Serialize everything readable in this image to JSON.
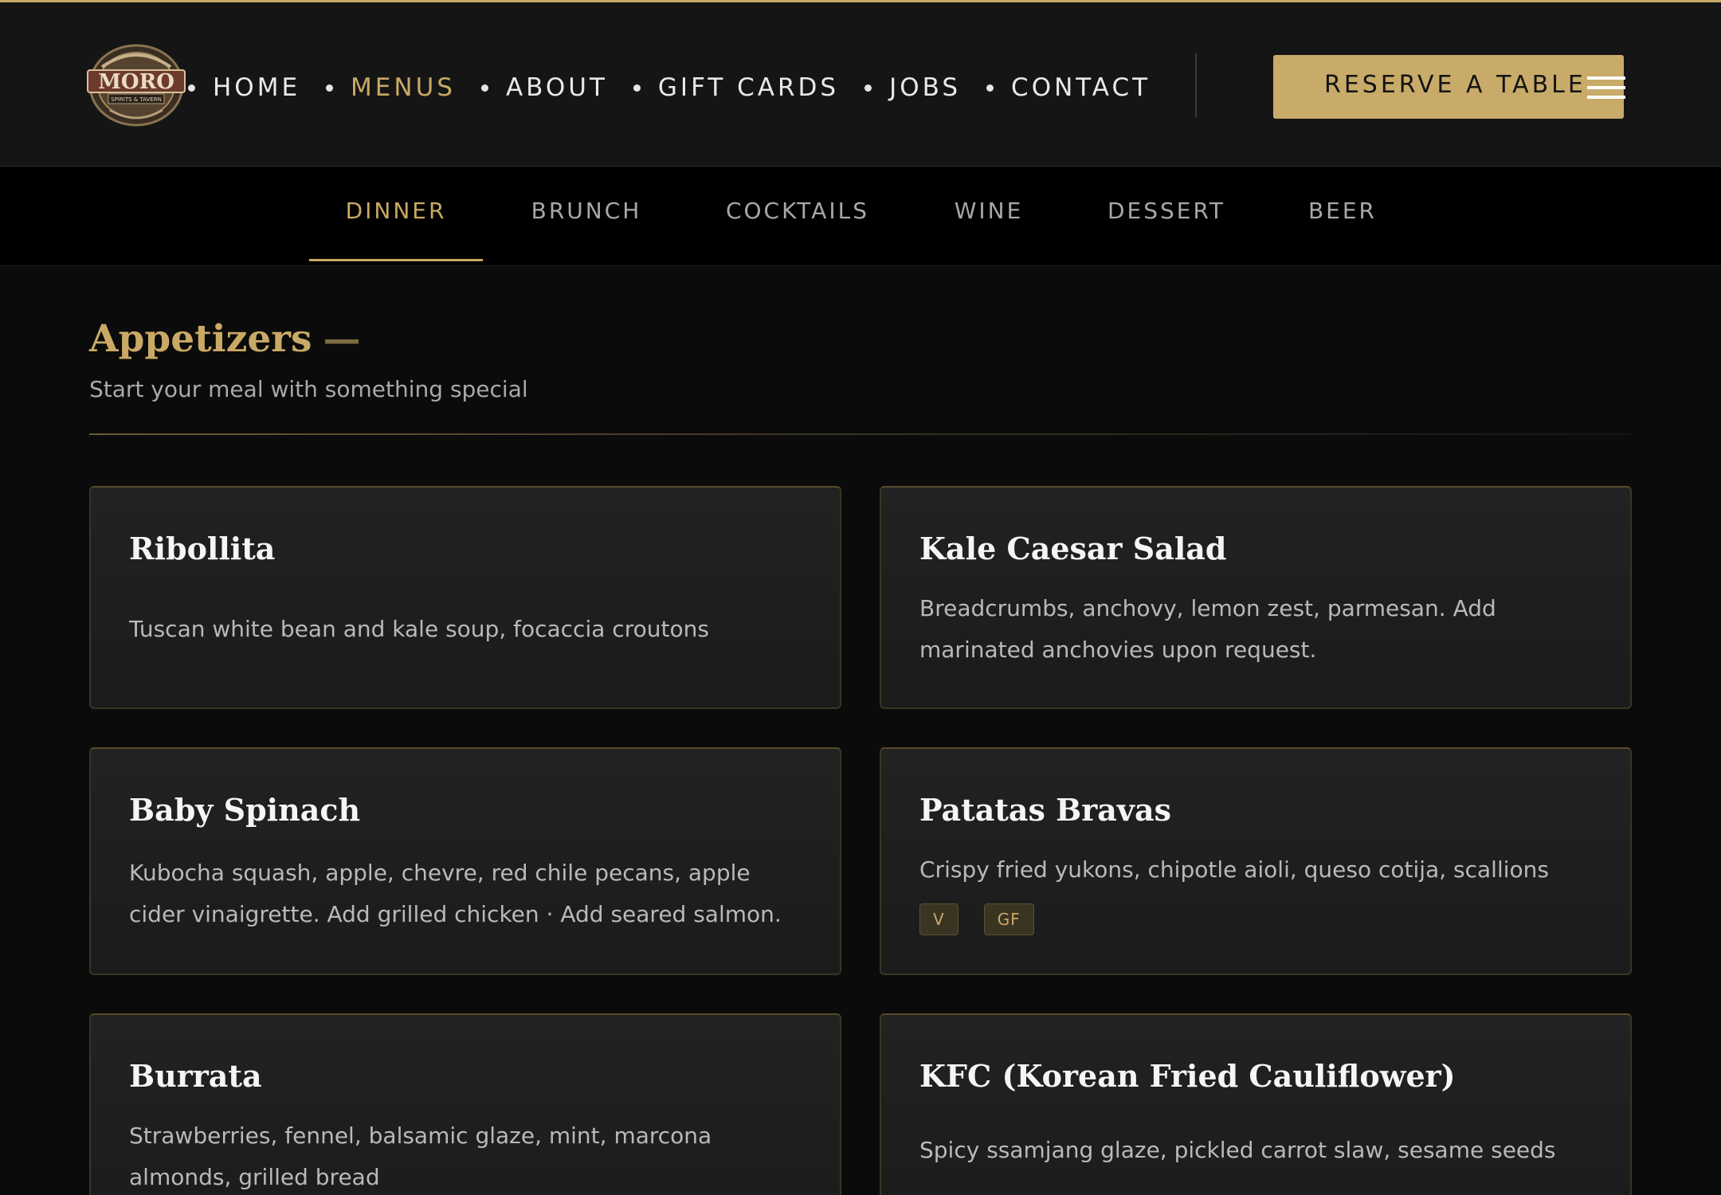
{
  "colors": {
    "accent": "#c9a965",
    "background": "#0b0b0b",
    "header": "#151516",
    "card": "#1f1f1f"
  },
  "logo": {
    "alt": "MORO",
    "text": "MORO",
    "tagline": "SPIRITS & TAVERN"
  },
  "nav": {
    "items": [
      {
        "label": "HOME",
        "active": false
      },
      {
        "label": "MENUS",
        "active": true
      },
      {
        "label": "ABOUT",
        "active": false
      },
      {
        "label": "GIFT CARDS",
        "active": false
      },
      {
        "label": "JOBS",
        "active": false
      },
      {
        "label": "CONTACT",
        "active": false
      }
    ],
    "reserve_label": "RESERVE A TABLE",
    "menu_icon": "hamburger-icon"
  },
  "tabs": [
    {
      "label": "DINNER",
      "active": true
    },
    {
      "label": "BRUNCH",
      "active": false
    },
    {
      "label": "COCKTAILS",
      "active": false
    },
    {
      "label": "WINE",
      "active": false
    },
    {
      "label": "DESSERT",
      "active": false
    },
    {
      "label": "BEER",
      "active": false
    }
  ],
  "section": {
    "title": "Appetizers",
    "dash": "—",
    "subtitle": "Start your meal with something special"
  },
  "items": [
    {
      "name": "Ribollita",
      "description": "Tuscan white bean and kale soup, focaccia croutons",
      "badges": []
    },
    {
      "name": "Kale Caesar Salad",
      "description": "Breadcrumbs, anchovy, lemon zest, parmesan. Add marinated anchovies upon request.",
      "badges": []
    },
    {
      "name": "Baby Spinach",
      "description": "Kubocha squash, apple, chevre, red chile pecans, apple cider vinaigrette. Add grilled chicken · Add seared salmon.",
      "badges": []
    },
    {
      "name": "Patatas Bravas",
      "description": "Crispy fried yukons, chipotle aioli, queso cotija, scallions",
      "badges": [
        "V",
        "GF"
      ]
    },
    {
      "name": "Burrata",
      "description": "Strawberries, fennel, balsamic glaze, mint, marcona almonds, grilled bread",
      "badges": []
    },
    {
      "name": "KFC (Korean Fried Cauliflower)",
      "description": "Spicy ssamjang glaze, pickled carrot slaw, sesame seeds",
      "badges": []
    }
  ]
}
